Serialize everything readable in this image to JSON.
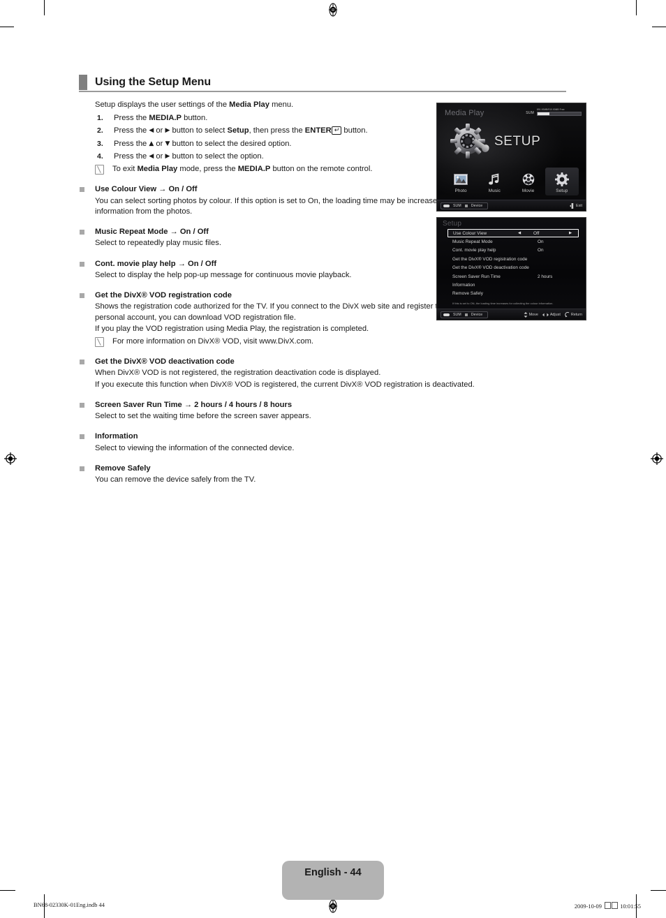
{
  "header": {
    "title": "Using the Setup Menu"
  },
  "intro": {
    "line_pre": "Setup displays the user settings of the ",
    "line_bold": "Media Play",
    "line_post": " menu."
  },
  "steps": [
    {
      "num": "1.",
      "parts": [
        {
          "t": "Press the ",
          "b": false
        },
        {
          "t": "MEDIA.P",
          "b": true
        },
        {
          "t": " button.",
          "b": false
        }
      ]
    },
    {
      "num": "2.",
      "parts": [
        {
          "t": "Press the ",
          "b": false
        },
        {
          "t": "◀",
          "b": false,
          "sym": true
        },
        {
          "t": " or ",
          "b": false
        },
        {
          "t": "▶",
          "b": false,
          "sym": true
        },
        {
          "t": " button to select ",
          "b": false
        },
        {
          "t": "Setup",
          "b": true
        },
        {
          "t": ", then press the ",
          "b": false
        },
        {
          "t": "ENTER",
          "b": true
        },
        {
          "t": "↵",
          "b": false,
          "key": true
        },
        {
          "t": " button.",
          "b": false
        }
      ]
    },
    {
      "num": "3.",
      "parts": [
        {
          "t": "Press the ",
          "b": false
        },
        {
          "t": "▲",
          "b": false,
          "sym": true
        },
        {
          "t": " or ",
          "b": false
        },
        {
          "t": "▼",
          "b": false,
          "sym": true
        },
        {
          "t": " button to select the desired option.",
          "b": false
        }
      ]
    },
    {
      "num": "4.",
      "parts": [
        {
          "t": "Press the ",
          "b": false
        },
        {
          "t": "◀",
          "b": false,
          "sym": true
        },
        {
          "t": " or ",
          "b": false
        },
        {
          "t": "▶",
          "b": false,
          "sym": true
        },
        {
          "t": " button to select the option.",
          "b": false
        }
      ]
    }
  ],
  "step_note": {
    "parts": [
      {
        "t": "To exit ",
        "b": false
      },
      {
        "t": "Media Play",
        "b": true
      },
      {
        "t": " mode, press the ",
        "b": false
      },
      {
        "t": "MEDIA.P",
        "b": true
      },
      {
        "t": " button on the remote control.",
        "b": false
      }
    ]
  },
  "bullets": [
    {
      "title": "Use Colour View → On / Off",
      "paragraphs": [
        "You can select sorting photos by colour. If this option is set to On, the loading time may be increased to collect colour information from the photos."
      ],
      "notes": []
    },
    {
      "title": "Music Repeat Mode → On / Off",
      "paragraphs": [
        "Select to repeatedly play music files."
      ],
      "notes": []
    },
    {
      "title": "Cont. movie play help → On / Off",
      "paragraphs": [
        "Select to display the help pop-up message for continuous movie playback."
      ],
      "notes": []
    },
    {
      "title": "Get the DivX® VOD registration code",
      "paragraphs": [
        "Shows the registration code authorized for the TV. If you connect to the DivX web site and register the registration code with a personal account, you can download VOD registration file.",
        "If you play the VOD registration using Media Play, the registration is completed."
      ],
      "notes": [
        "For more information on DivX® VOD, visit www.DivX.com."
      ]
    },
    {
      "title": "Get the DivX® VOD deactivation code",
      "paragraphs": [
        "When DivX® VOD is not registered, the registration deactivation code is displayed.",
        "If you execute this function when DivX® VOD is registered, the current DivX® VOD registration is deactivated."
      ],
      "notes": []
    },
    {
      "title": "Screen Saver Run Time → 2 hours / 4 hours / 8 hours",
      "paragraphs": [
        "Select to set the waiting time before the screen saver appears."
      ],
      "notes": []
    },
    {
      "title": "Information",
      "paragraphs": [
        "Select to viewing the information of the connected device."
      ],
      "notes": []
    },
    {
      "title": "Remove Safely",
      "paragraphs": [
        "You can remove the device safely from the TV."
      ],
      "notes": []
    }
  ],
  "tv_screenshot_1": {
    "title": "Media Play",
    "storage_label": "SUM",
    "storage_capacity": "891.00MB/910.00MB Free",
    "hero_label": "SETUP",
    "icons": [
      {
        "name": "Photo",
        "icon": "photo-icon",
        "selected": false
      },
      {
        "name": "Music",
        "icon": "music-note-icon",
        "selected": false
      },
      {
        "name": "Movie",
        "icon": "film-reel-icon",
        "selected": false
      },
      {
        "name": "Setup",
        "icon": "gear-icon",
        "selected": true
      }
    ],
    "bottom_left": [
      "SUM",
      "Device"
    ],
    "bottom_right": [
      {
        "key": "exit",
        "label": "Exit"
      }
    ]
  },
  "tv_screenshot_2": {
    "title": "Setup",
    "rows": [
      {
        "label": "Use Colour View",
        "value": "Off",
        "highlighted": true,
        "adjustable": true
      },
      {
        "label": "Music Repeat Mode",
        "value": "On",
        "highlighted": false,
        "adjustable": false
      },
      {
        "label": "Cont. movie play help",
        "value": "On",
        "highlighted": false,
        "adjustable": false
      },
      {
        "label": "Get the DivX® VOD registration code",
        "value": "",
        "highlighted": false,
        "adjustable": false
      },
      {
        "label": "Get the DivX® VOD deactivation code",
        "value": "",
        "highlighted": false,
        "adjustable": false
      },
      {
        "label": "Screen Saver Run Time",
        "value": "2 hours",
        "highlighted": false,
        "adjustable": false
      },
      {
        "label": "Information",
        "value": "",
        "highlighted": false,
        "adjustable": false
      },
      {
        "label": "Remove Safely",
        "value": "",
        "highlighted": false,
        "adjustable": false
      }
    ],
    "help_text": "If this is set to ON, the loading time increases for collecting the colour information.",
    "bottom_left": [
      "SUM",
      "Device"
    ],
    "bottom_right": [
      {
        "key": "move",
        "label": "Move"
      },
      {
        "key": "adjust",
        "label": "Adjust"
      },
      {
        "key": "return",
        "label": "Return"
      }
    ]
  },
  "footer": {
    "page_label": "English - 44",
    "file_ref": "BN68-02330K-01Eng.indb   44",
    "date": "2009-10-09",
    "time": "10:01:55"
  }
}
